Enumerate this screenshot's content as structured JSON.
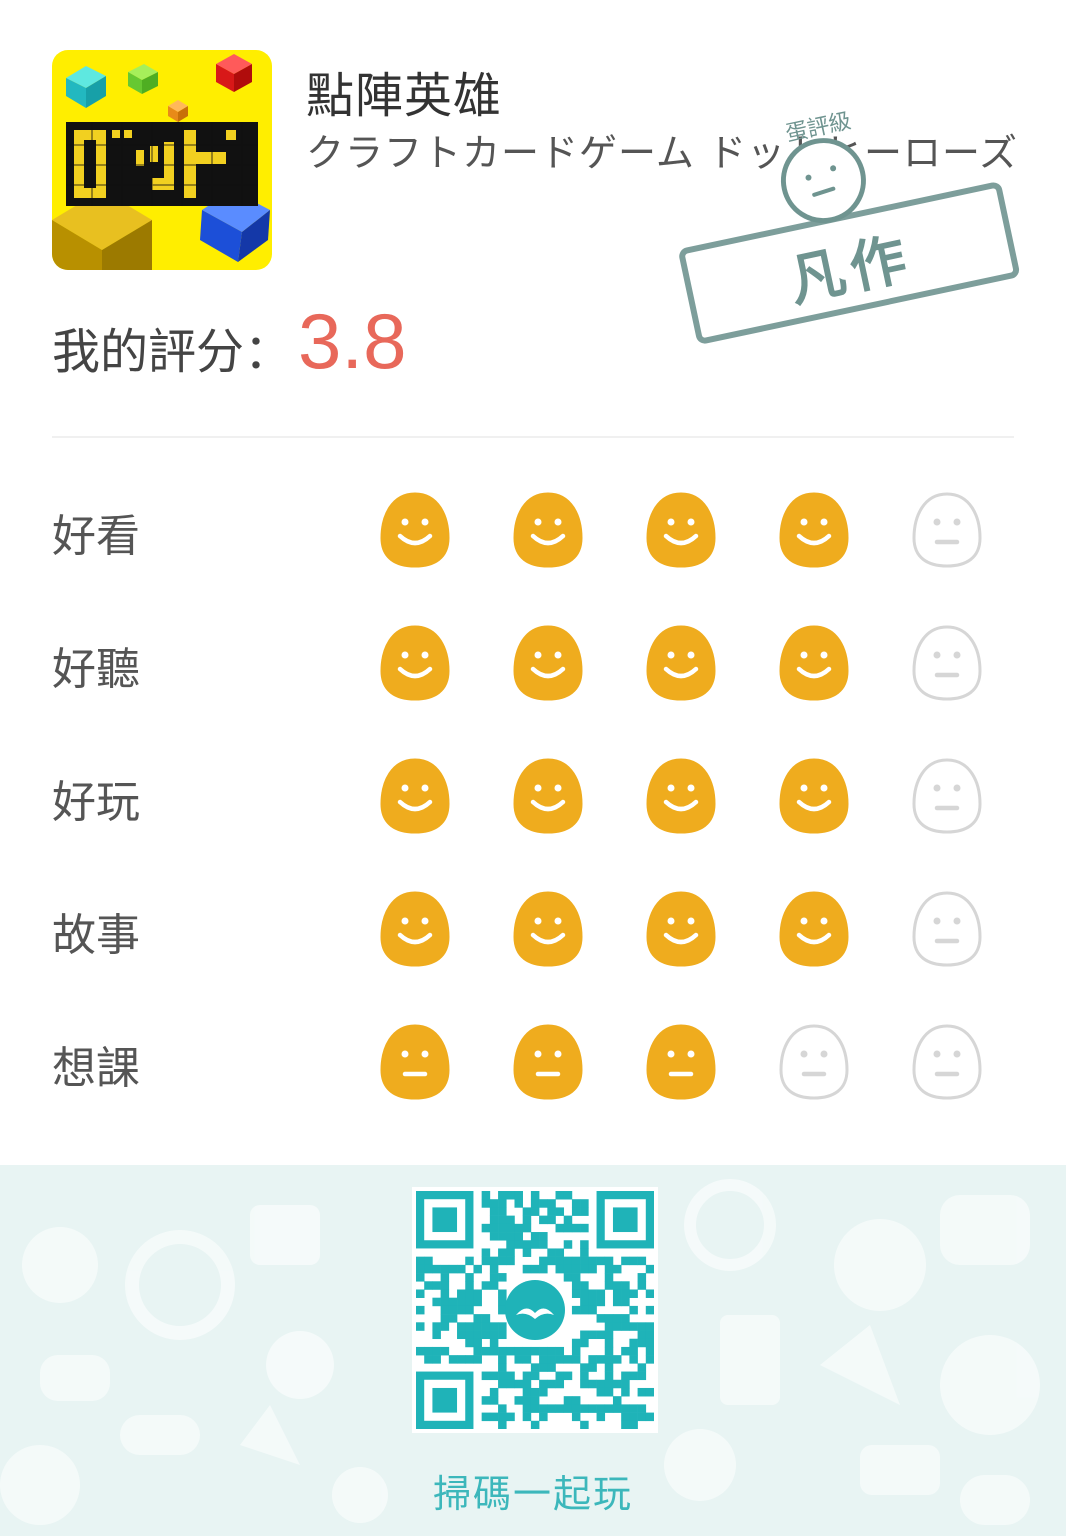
{
  "app": {
    "title_zh": "點陣英雄",
    "title_ja": "クラフトカードゲーム ドットヒーローズ",
    "icon_text": "ドット",
    "icon_name": "dot-heroes-app-icon"
  },
  "my_rating": {
    "label": "我的評分：",
    "score": "3.8"
  },
  "stamp": {
    "top_text": "蛋評級",
    "verdict": "凡作",
    "icon_name": "neutral-face-stamp"
  },
  "ratings": [
    {
      "label": "好看",
      "filled": 4,
      "total": 5,
      "expression": "smile"
    },
    {
      "label": "好聽",
      "filled": 4,
      "total": 5,
      "expression": "smile"
    },
    {
      "label": "好玩",
      "filled": 4,
      "total": 5,
      "expression": "smile"
    },
    {
      "label": "故事",
      "filled": 4,
      "total": 5,
      "expression": "smile"
    },
    {
      "label": "想課",
      "filled": 3,
      "total": 5,
      "expression": "neutral"
    }
  ],
  "colors": {
    "accent": "#efac1e",
    "empty_face": "#d6d6d6",
    "score": "#e8685a",
    "footer_bg": "#e8f4f3",
    "qr": "#1fb3b8"
  },
  "footer": {
    "scan_text": "掃碼一起玩"
  }
}
